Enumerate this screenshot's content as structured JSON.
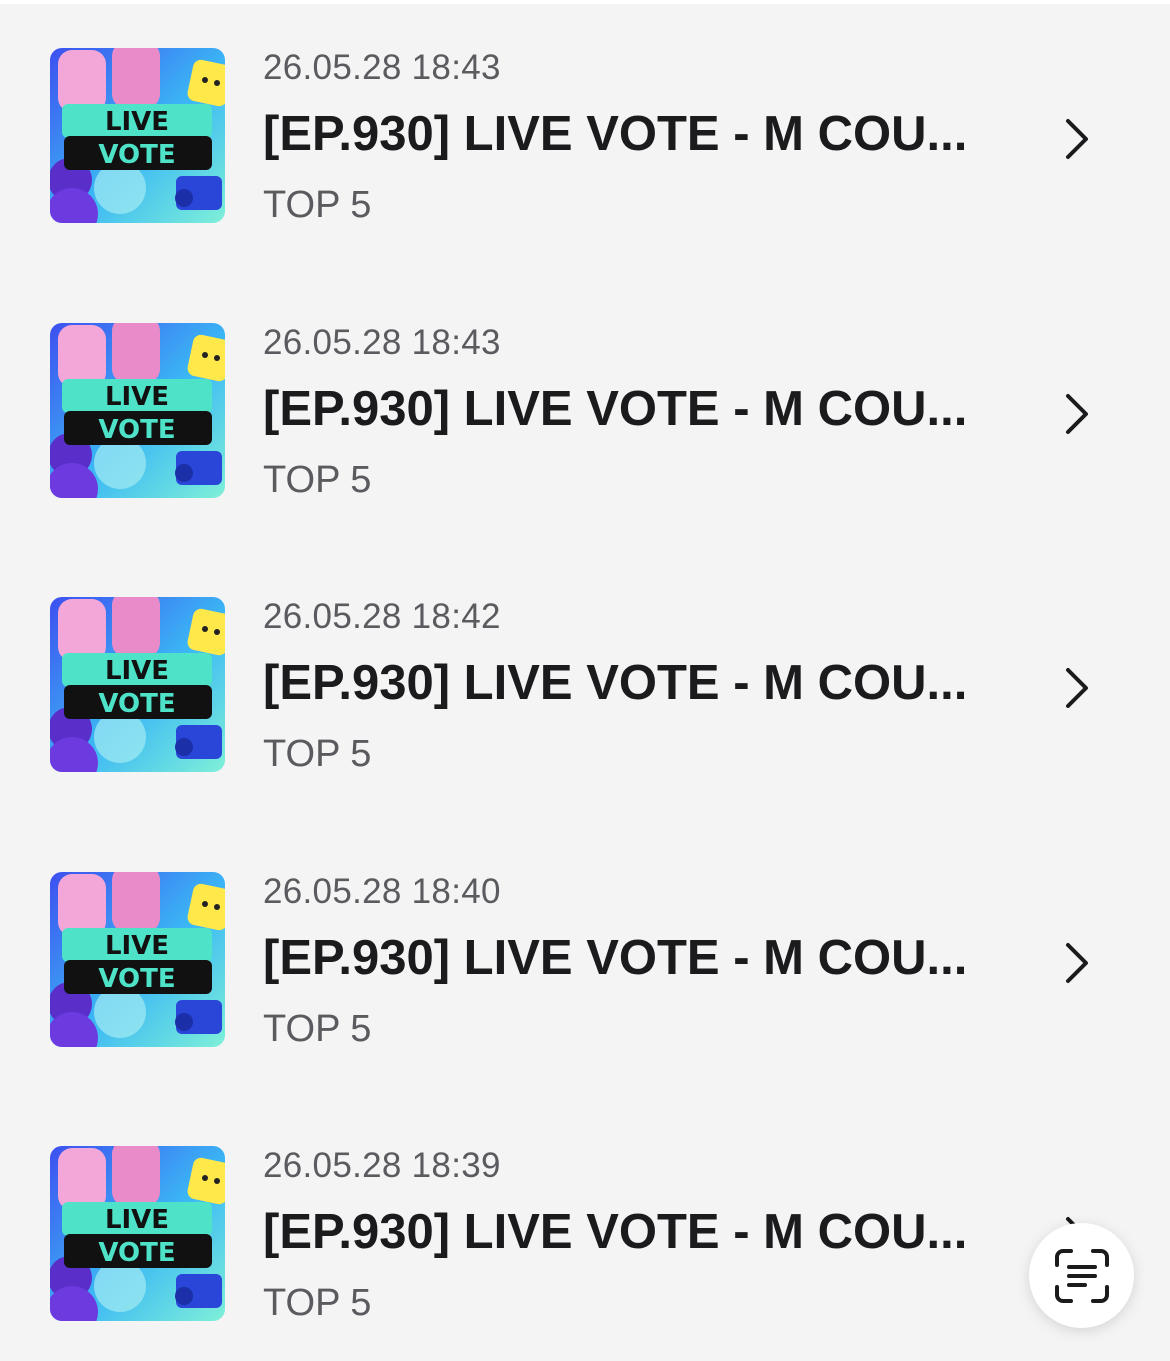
{
  "thumbnail": {
    "badge_line1": "LIVE",
    "badge_line2": "VOTE",
    "icon": "live-vote-artwork"
  },
  "items": [
    {
      "date": "26.05.28 18:43",
      "title": "[EP.930] LIVE VOTE - M COU...",
      "subtitle": "TOP 5"
    },
    {
      "date": "26.05.28 18:43",
      "title": "[EP.930] LIVE VOTE - M COU...",
      "subtitle": "TOP 5"
    },
    {
      "date": "26.05.28 18:42",
      "title": "[EP.930] LIVE VOTE - M COU...",
      "subtitle": "TOP 5"
    },
    {
      "date": "26.05.28 18:40",
      "title": "[EP.930] LIVE VOTE - M COU...",
      "subtitle": "TOP 5"
    },
    {
      "date": "26.05.28 18:39",
      "title": "[EP.930] LIVE VOTE - M COU...",
      "subtitle": "TOP 5"
    }
  ],
  "icons": {
    "row_action": "chevron-right-icon",
    "floating_action": "text-scan-icon"
  },
  "colors": {
    "background": "#f4f4f5",
    "title": "#1b1b1d",
    "secondary": "#5b5b5f",
    "badge_teal": "#4ee3c8",
    "badge_black": "#111111"
  }
}
